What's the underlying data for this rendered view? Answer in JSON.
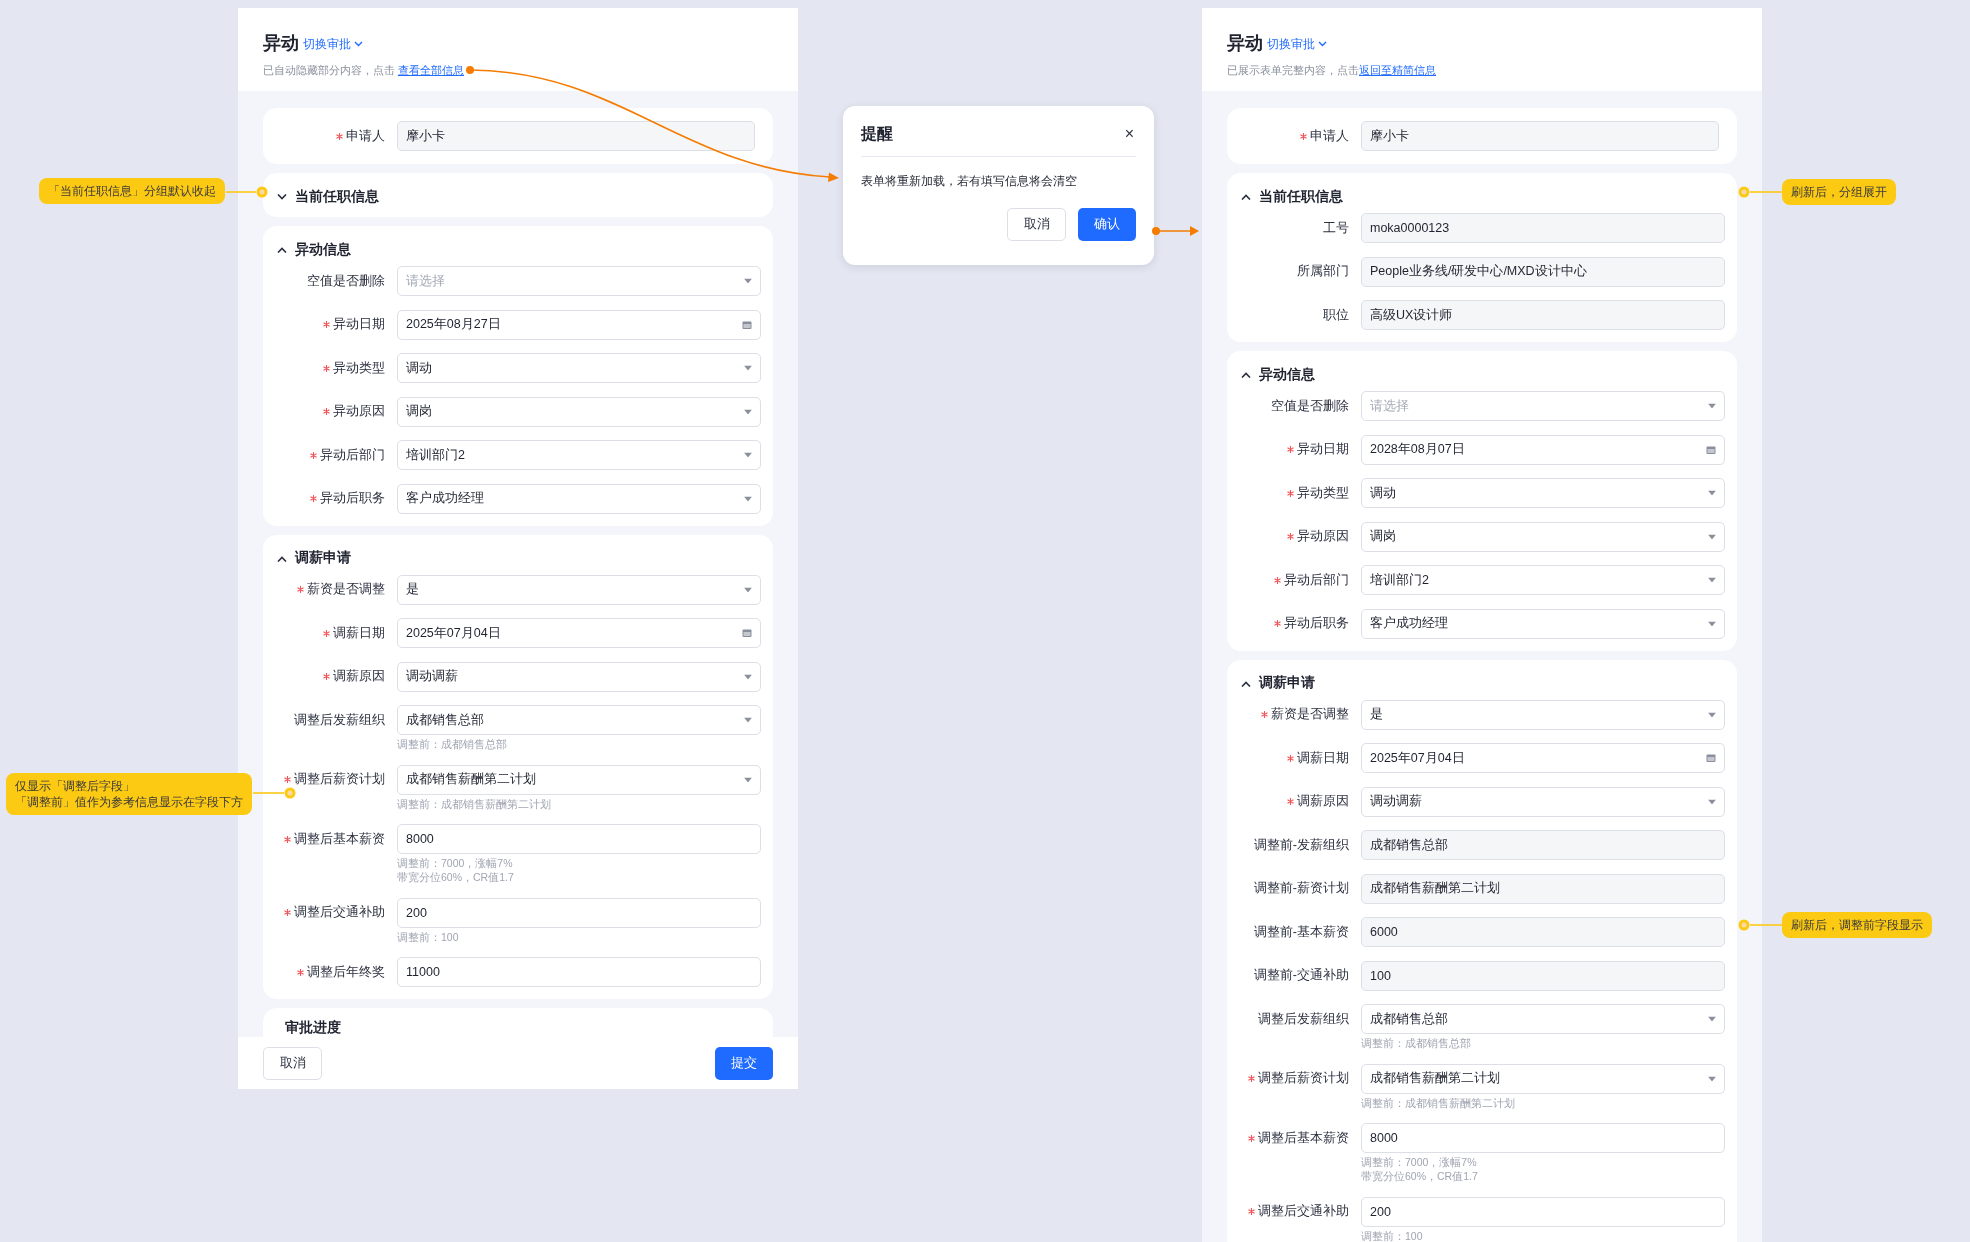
{
  "panels": [
    {
      "title": "异动",
      "switch_label": "切换审批",
      "notice": "已自动隐藏部分内容，点击 ",
      "notice_link": "查看全部信息",
      "groups": [
        {
          "fields": [
            {
              "label": "申请人",
              "required": true,
              "kind": "readonly",
              "value": "摩小卡"
            }
          ]
        },
        {
          "title": "当前任职信息",
          "expanded": false
        },
        {
          "title": "异动信息",
          "expanded": true,
          "fields": [
            {
              "label": "空值是否删除",
              "required": false,
              "kind": "select",
              "placeholder": "请选择"
            },
            {
              "label": "异动日期",
              "required": true,
              "kind": "date",
              "value": "2025年08月27日"
            },
            {
              "label": "异动类型",
              "required": true,
              "kind": "select",
              "value": "调动"
            },
            {
              "label": "异动原因",
              "required": true,
              "kind": "select",
              "value": "调岗"
            },
            {
              "label": "异动后部门",
              "required": true,
              "kind": "select",
              "value": "培训部门2"
            },
            {
              "label": "异动后职务",
              "required": true,
              "kind": "select",
              "value": "客户成功经理"
            }
          ]
        },
        {
          "title": "调薪申请",
          "expanded": true,
          "fields": [
            {
              "label": "薪资是否调整",
              "required": true,
              "kind": "select",
              "value": "是"
            },
            {
              "label": "调薪日期",
              "required": true,
              "kind": "date",
              "value": "2025年07月04日"
            },
            {
              "label": "调薪原因",
              "required": true,
              "kind": "select",
              "value": "调动调薪"
            },
            {
              "label": "调整后发薪组织",
              "required": false,
              "kind": "select",
              "value": "成都销售总部",
              "hints": [
                "调整前：成都销售总部"
              ]
            },
            {
              "label": "调整后薪资计划",
              "required": true,
              "kind": "select",
              "value": "成都销售薪酬第二计划",
              "hints": [
                "调整前：成都销售薪酬第二计划"
              ]
            },
            {
              "label": "调整后基本薪资",
              "required": true,
              "kind": "text",
              "value": "8000",
              "hints": [
                "调整前：7000，涨幅7%",
                "带宽分位60%，CR值1.7"
              ]
            },
            {
              "label": "调整后交通补助",
              "required": true,
              "kind": "text",
              "value": "200",
              "hints": [
                "调整前：100"
              ]
            },
            {
              "label": "调整后年终奖",
              "required": true,
              "kind": "text",
              "value": "11000"
            }
          ]
        },
        {
          "title": "审批进度"
        }
      ],
      "footer": {
        "cancel": "取消",
        "submit": "提交"
      }
    },
    {
      "title": "异动",
      "switch_label": "切换审批",
      "notice": "已展示表单完整内容，点击",
      "notice_link": "返回至精简信息",
      "groups": [
        {
          "fields": [
            {
              "label": "申请人",
              "required": true,
              "kind": "readonly",
              "value": "摩小卡"
            }
          ]
        },
        {
          "title": "当前任职信息",
          "expanded": true,
          "fields": [
            {
              "label": "工号",
              "required": false,
              "kind": "readonly",
              "value": "moka0000123"
            },
            {
              "label": "所属部门",
              "required": false,
              "kind": "readonly",
              "value": "People业务线/研发中心/MXD设计中心"
            },
            {
              "label": "职位",
              "required": false,
              "kind": "readonly",
              "value": "高级UX设计师"
            }
          ]
        },
        {
          "title": "异动信息",
          "expanded": true,
          "fields": [
            {
              "label": "空值是否删除",
              "required": false,
              "kind": "select",
              "placeholder": "请选择"
            },
            {
              "label": "异动日期",
              "required": true,
              "kind": "date",
              "value": "2028年08月07日"
            },
            {
              "label": "异动类型",
              "required": true,
              "kind": "select",
              "value": "调动"
            },
            {
              "label": "异动原因",
              "required": true,
              "kind": "select",
              "value": "调岗"
            },
            {
              "label": "异动后部门",
              "required": true,
              "kind": "select",
              "value": "培训部门2"
            },
            {
              "label": "异动后职务",
              "required": true,
              "kind": "select",
              "value": "客户成功经理"
            }
          ]
        },
        {
          "title": "调薪申请",
          "expanded": true,
          "fields": [
            {
              "label": "薪资是否调整",
              "required": true,
              "kind": "select",
              "value": "是"
            },
            {
              "label": "调薪日期",
              "required": true,
              "kind": "date",
              "value": "2025年07月04日"
            },
            {
              "label": "调薪原因",
              "required": true,
              "kind": "select",
              "value": "调动调薪"
            },
            {
              "label": "调整前-发薪组织",
              "required": false,
              "kind": "readonly",
              "value": "成都销售总部"
            },
            {
              "label": "调整前-薪资计划",
              "required": false,
              "kind": "readonly",
              "value": "成都销售薪酬第二计划"
            },
            {
              "label": "调整前-基本薪资",
              "required": false,
              "kind": "readonly",
              "value": "6000"
            },
            {
              "label": "调整前-交通补助",
              "required": false,
              "kind": "readonly",
              "value": "100"
            },
            {
              "label": "调整后发薪组织",
              "required": false,
              "kind": "select",
              "value": "成都销售总部",
              "hints": [
                "调整前：成都销售总部"
              ]
            },
            {
              "label": "调整后薪资计划",
              "required": true,
              "kind": "select",
              "value": "成都销售薪酬第二计划",
              "hints": [
                "调整前：成都销售薪酬第二计划"
              ]
            },
            {
              "label": "调整后基本薪资",
              "required": true,
              "kind": "text",
              "value": "8000",
              "hints": [
                "调整前：7000，涨幅7%",
                "带宽分位60%，CR值1.7"
              ]
            },
            {
              "label": "调整后交通补助",
              "required": true,
              "kind": "text",
              "value": "200",
              "hints": [
                "调整前：100"
              ]
            }
          ]
        }
      ]
    }
  ],
  "dialog": {
    "title": "提醒",
    "close": "×",
    "message": "表单将重新加载，若有填写信息将会清空",
    "cancel": "取消",
    "confirm": "确认"
  },
  "notes": [
    {
      "lines": [
        "「当前任职信息」分组默认收起"
      ]
    },
    {
      "lines": [
        "仅显示「调整后字段」",
        "「调整前」值作为参考信息显示在字段下方"
      ]
    },
    {
      "lines": [
        "刷新后，分组展开"
      ]
    },
    {
      "lines": [
        "刷新后，调整前字段显示"
      ]
    }
  ]
}
